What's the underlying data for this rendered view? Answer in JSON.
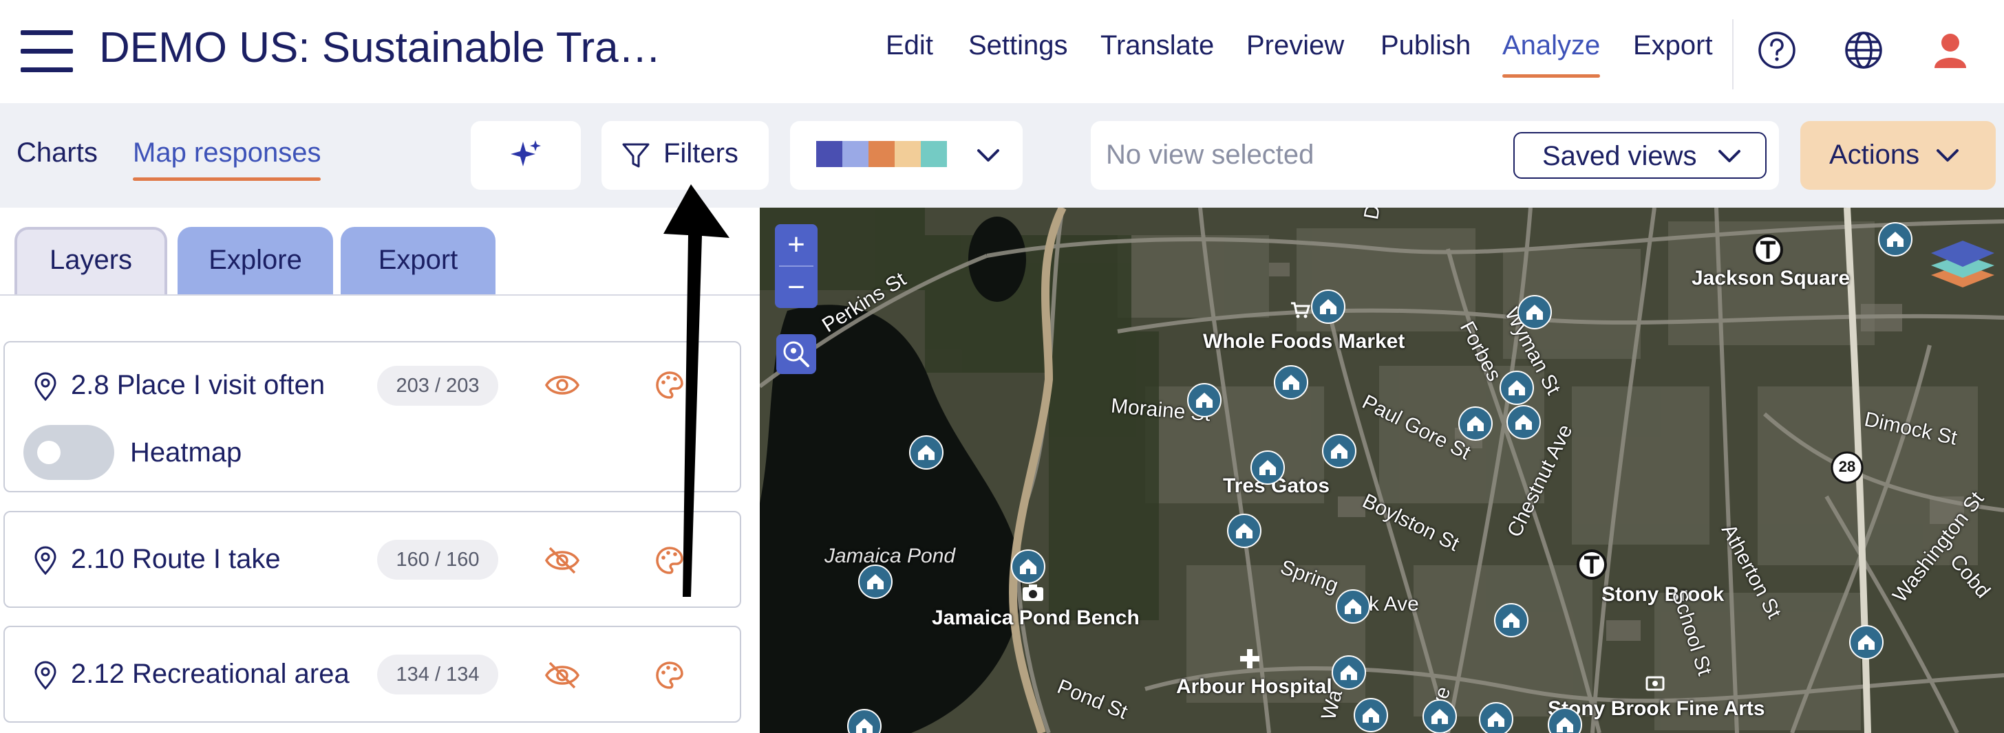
{
  "header": {
    "title": "DEMO US: Sustainable Tra…",
    "nav": [
      "Edit",
      "Settings",
      "Translate",
      "Preview",
      "Publish",
      "Analyze",
      "Export"
    ],
    "active_nav": "Analyze",
    "icons": [
      "help-icon",
      "globe-icon",
      "user-icon"
    ]
  },
  "toolbar": {
    "tabs": [
      "Charts",
      "Map responses"
    ],
    "active_tab": "Map responses",
    "ai_icon": "sparkles-icon",
    "filters_label": "Filters",
    "color_swatches": [
      "#4a4fb1",
      "#9aa9e6",
      "#e0854f",
      "#f2cd98",
      "#74cbc4"
    ],
    "view_placeholder": "No view selected",
    "saved_views_label": "Saved views",
    "actions_label": "Actions"
  },
  "panel": {
    "tabs": [
      "Layers",
      "Explore",
      "Export"
    ],
    "active_tab": "Layers",
    "layers": [
      {
        "title": "2.8 Place I visit often",
        "count": "203 / 203",
        "visible": true,
        "heatmap_label": "Heatmap",
        "heatmap_on": false
      },
      {
        "title": "2.10 Route I take",
        "count": "160 / 160",
        "visible": false
      },
      {
        "title": "2.12 Recreational area",
        "count": "134 / 134",
        "visible": false
      }
    ]
  },
  "map": {
    "zoom_in": "+",
    "zoom_out": "−",
    "labels": [
      "Perkins St",
      "Whole Foods Market",
      "Moraine St",
      "Paul Gore St",
      "Forbes",
      "Wyman St",
      "Jackson Square",
      "Dimock St",
      "Tres Gatos",
      "Boylston St",
      "Chestnut Ave",
      "Jamaica Pond",
      "Jamaica Pond Bench",
      "Spring",
      "k Ave",
      "Stony Brook",
      "School St",
      "Atherton St",
      "Washington St",
      "Cobd",
      "Pond St",
      "Arbour Hospital",
      "Stony Brook Fine Arts",
      "Da",
      "Wa",
      "Ave"
    ],
    "route_shield": "28",
    "transit_icon": "T"
  },
  "colors": {
    "brand_text": "#1b1f63",
    "accent": "#e07a49",
    "active_link": "#3d52b8",
    "tab_blue": "#9aaee8",
    "actions_bg": "#f6d8b4",
    "marker": "#2f6a8c"
  }
}
